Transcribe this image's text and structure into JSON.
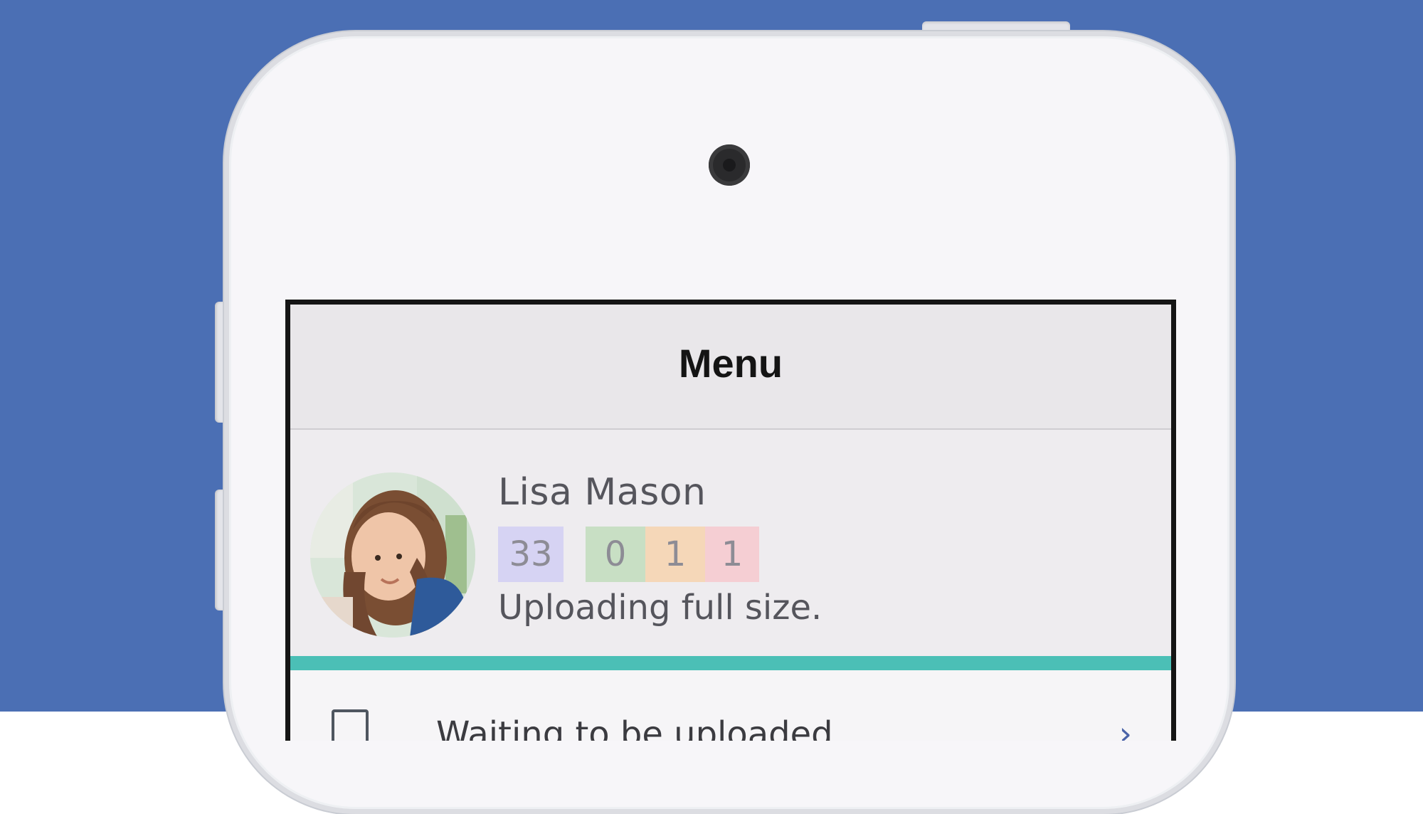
{
  "colors": {
    "background": "#4b6fb4",
    "phone_body": "#f7f6f9",
    "phone_buttons": "#e3e4e9",
    "progress_fill": "#4bbfb6",
    "badge_purple": "#d6d3f3",
    "badge_green": "#c8dfc4",
    "badge_orange": "#f5d7b8",
    "badge_pink": "#f5ced3"
  },
  "nav": {
    "title": "Menu"
  },
  "profile": {
    "name": "Lisa Mason",
    "avatar_icon": "user-photo",
    "status": "Uploading full size."
  },
  "badges": [
    {
      "value": "33",
      "color": "#d6d3f3"
    },
    {
      "value": "0",
      "color": "#c8dfc4"
    },
    {
      "value": "1",
      "color": "#f5d7b8"
    },
    {
      "value": "1",
      "color": "#f5ced3"
    }
  ],
  "upload_progress": 1.0,
  "list": {
    "first_item": {
      "checkbox_icon": "checkbox-empty-icon",
      "label": "Waiting to be uploaded",
      "chevron_icon": "chevron-right-icon"
    }
  }
}
